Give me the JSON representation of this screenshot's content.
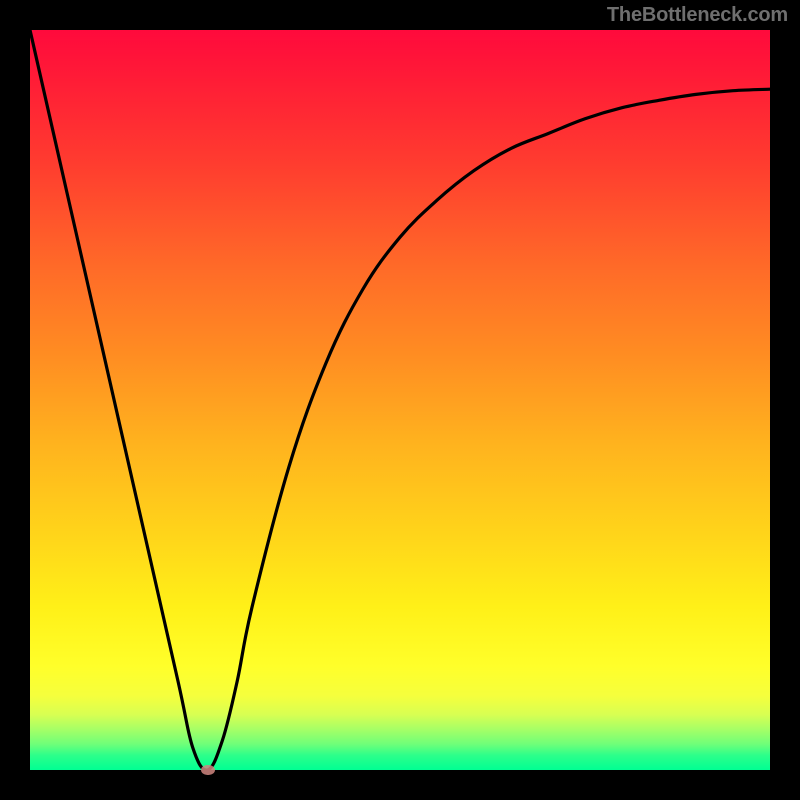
{
  "watermark": {
    "text": "TheBottleneck.com"
  },
  "chart_data": {
    "type": "line",
    "title": "",
    "xlabel": "",
    "ylabel": "",
    "xlim": [
      0,
      100
    ],
    "ylim": [
      0,
      100
    ],
    "grid": false,
    "legend": false,
    "gradient": {
      "orientation": "vertical",
      "stops": [
        {
          "pos": 0,
          "color": "#ff0a3c"
        },
        {
          "pos": 50,
          "color": "#ff9a1f"
        },
        {
          "pos": 85,
          "color": "#ffff2a"
        },
        {
          "pos": 100,
          "color": "#00ff93"
        }
      ]
    },
    "series": [
      {
        "name": "bottleneck-curve",
        "x": [
          0,
          5,
          10,
          15,
          20,
          22,
          24,
          26,
          28,
          30,
          35,
          40,
          45,
          50,
          55,
          60,
          65,
          70,
          75,
          80,
          85,
          90,
          95,
          100
        ],
        "values": [
          100,
          78,
          56,
          34,
          12,
          3,
          0,
          4,
          12,
          22,
          41,
          55,
          65,
          72,
          77,
          81,
          84,
          86,
          88,
          89.5,
          90.5,
          91.3,
          91.8,
          92
        ]
      }
    ],
    "marker": {
      "x": 24,
      "y": 0,
      "color": "#d08680"
    }
  }
}
